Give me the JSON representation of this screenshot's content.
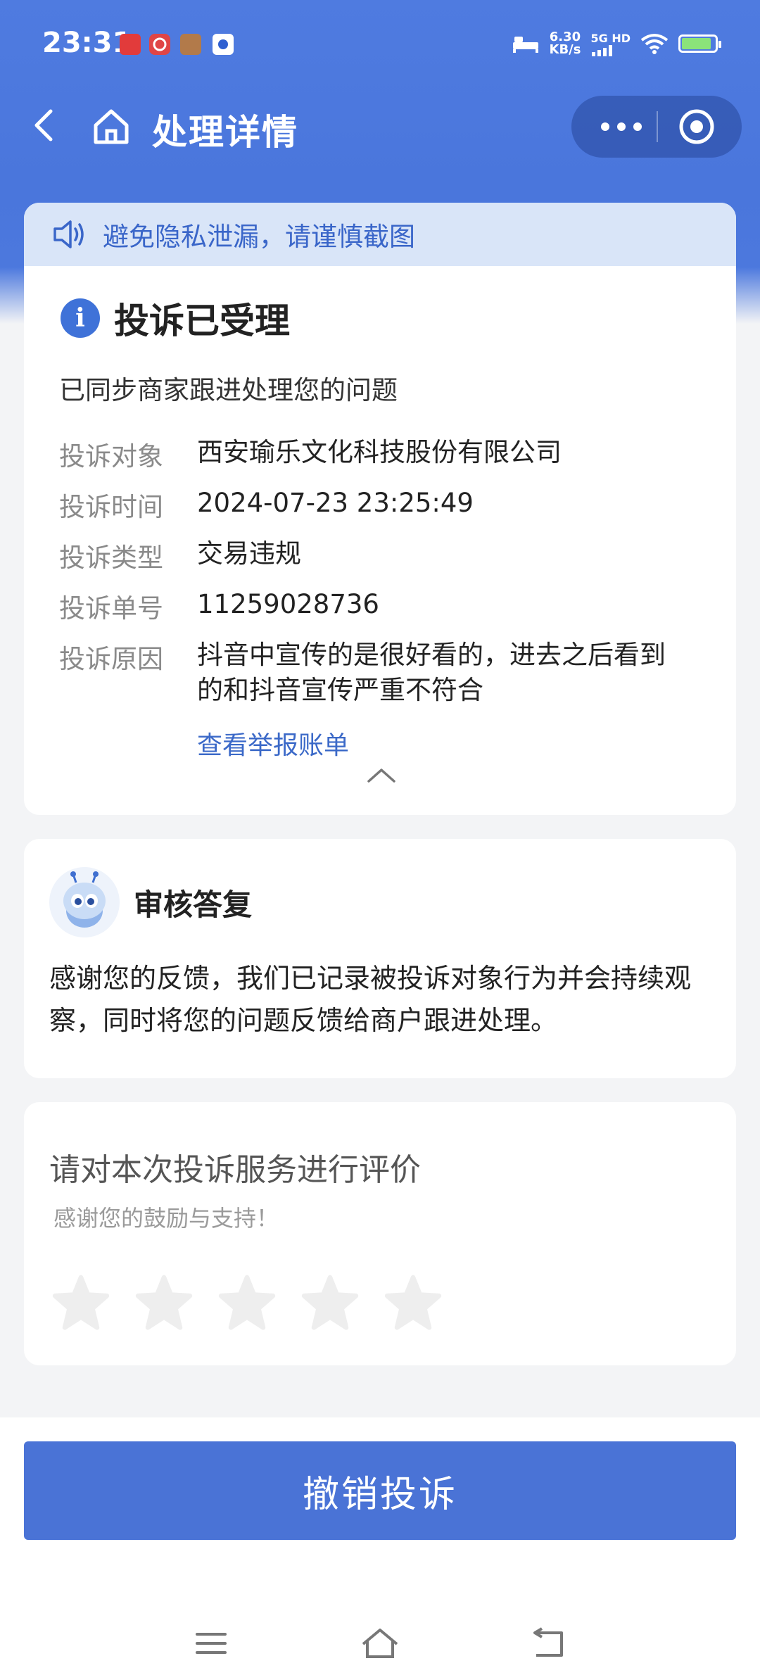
{
  "status_bar": {
    "time": "23:31",
    "net_speed_value": "6.30",
    "net_speed_unit": "KB/s",
    "signal_label": "5G HD",
    "battery_level": 0.9,
    "notification_icons": [
      "xiaohongshu-icon",
      "netease-music-icon",
      "game-avatar-icon",
      "baidu-icon"
    ]
  },
  "nav": {
    "title": "处理详情"
  },
  "notice": {
    "text": "避免隐私泄漏，请谨慎截图"
  },
  "complaint": {
    "status_title": "投诉已受理",
    "status_message": "已同步商家跟进处理您的问题",
    "fields": [
      {
        "label": "投诉对象",
        "value": "西安瑜乐文化科技股份有限公司"
      },
      {
        "label": "投诉时间",
        "value": "2024-07-23 23:25:49"
      },
      {
        "label": "投诉类型",
        "value": "交易违规"
      },
      {
        "label": "投诉单号",
        "value": "11259028736"
      },
      {
        "label": "投诉原因",
        "value": "抖音中宣传的是很好看的，进去之后看到的和抖音宣传严重不符合"
      }
    ],
    "link_text": "查看举报账单"
  },
  "review": {
    "title": "审核答复",
    "body": "感谢您的反馈，我们已记录被投诉对象行为并会持续观察，同时将您的问题反馈给商户跟进处理。"
  },
  "rating": {
    "title": "请对本次投诉服务进行评价",
    "subtitle": "感谢您的鼓励与支持！",
    "max_stars": 5,
    "selected_stars": 0
  },
  "actions": {
    "revoke_label": "撤销投诉"
  },
  "colors": {
    "header_blue": "#4f7be0",
    "accent_blue": "#3f72d8",
    "button_blue": "#4a73d6",
    "notice_bg": "#d9e5f8",
    "star_empty": "#eeeeee"
  }
}
